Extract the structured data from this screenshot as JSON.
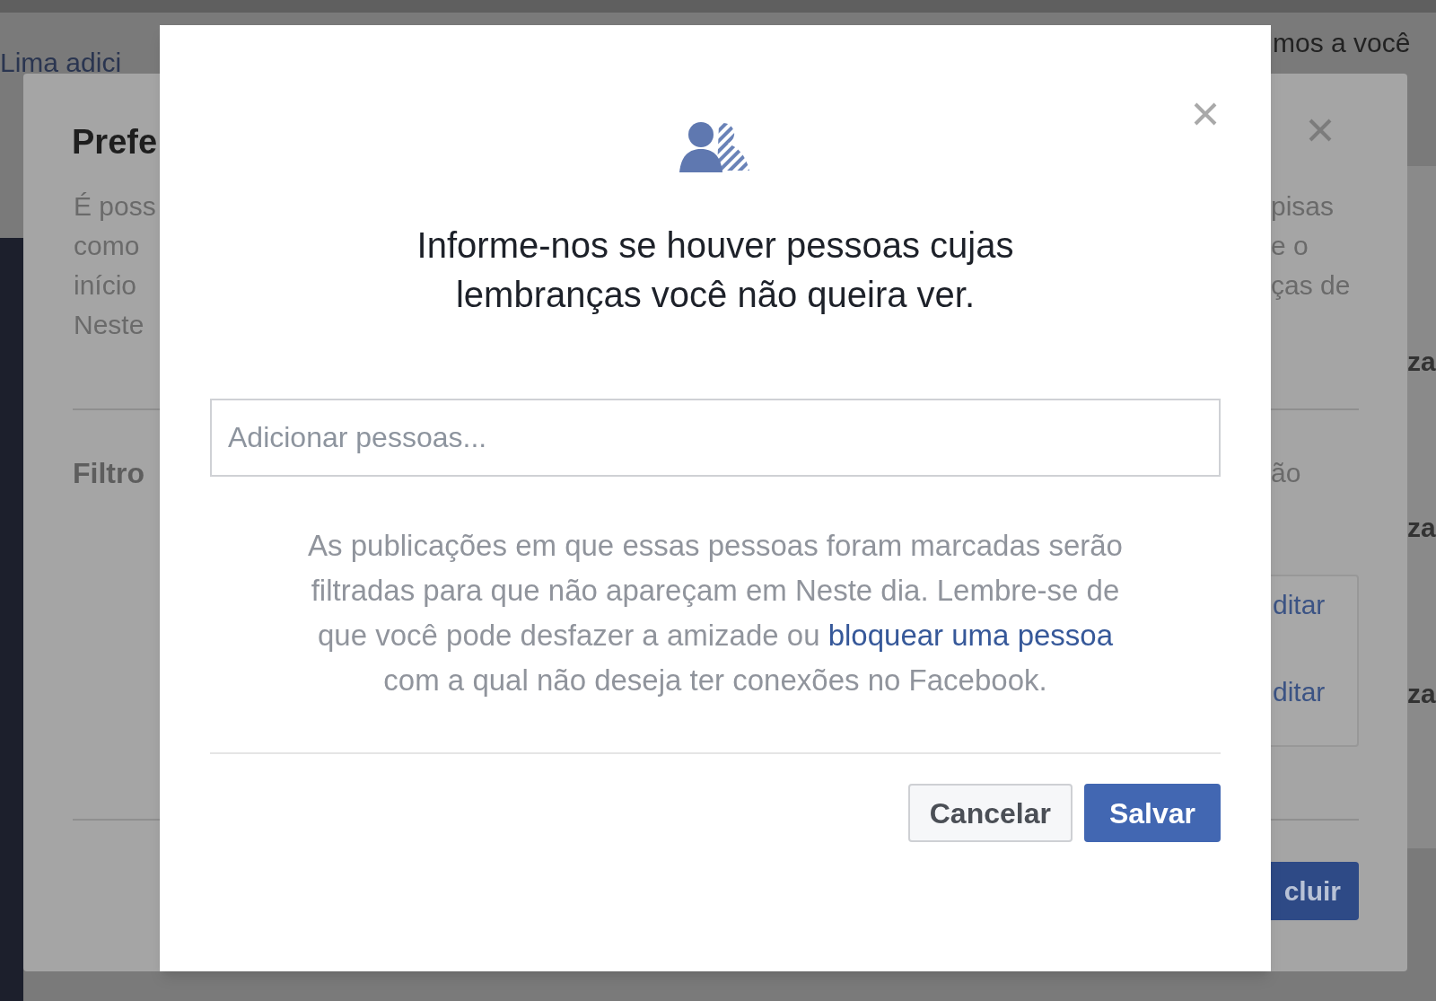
{
  "background_page": {
    "story_text": "Lima adici",
    "right_text": "mos a você",
    "right_edge_labels": [
      "za",
      "za",
      "za"
    ]
  },
  "back_dialog": {
    "title": "Prefe",
    "description_lines": [
      "É poss",
      "como",
      "início",
      "Neste"
    ],
    "section_title": "Filtro",
    "right_fragments": [
      "pisas",
      "e o",
      "ças de"
    ],
    "right_label": "ão",
    "edit_links": [
      "ditar",
      "ditar"
    ],
    "primary_button": "cluir"
  },
  "dialog": {
    "heading": "Informe-nos se houver pessoas cujas lembranças você não queira ver.",
    "search": {
      "placeholder": "Adicionar pessoas..."
    },
    "info_before": "As publicações em que essas pessoas foram marcadas serão filtradas para que não apareçam em Neste dia. Lembre-se de que você pode desfazer a amizade ou ",
    "info_link": "bloquear uma pessoa",
    "info_after": " com a qual não deseja ter conexões no Facebook.",
    "buttons": [
      {
        "label": "Cancelar",
        "kind": "secondary"
      },
      {
        "label": "Salvar",
        "kind": "primary"
      }
    ]
  }
}
